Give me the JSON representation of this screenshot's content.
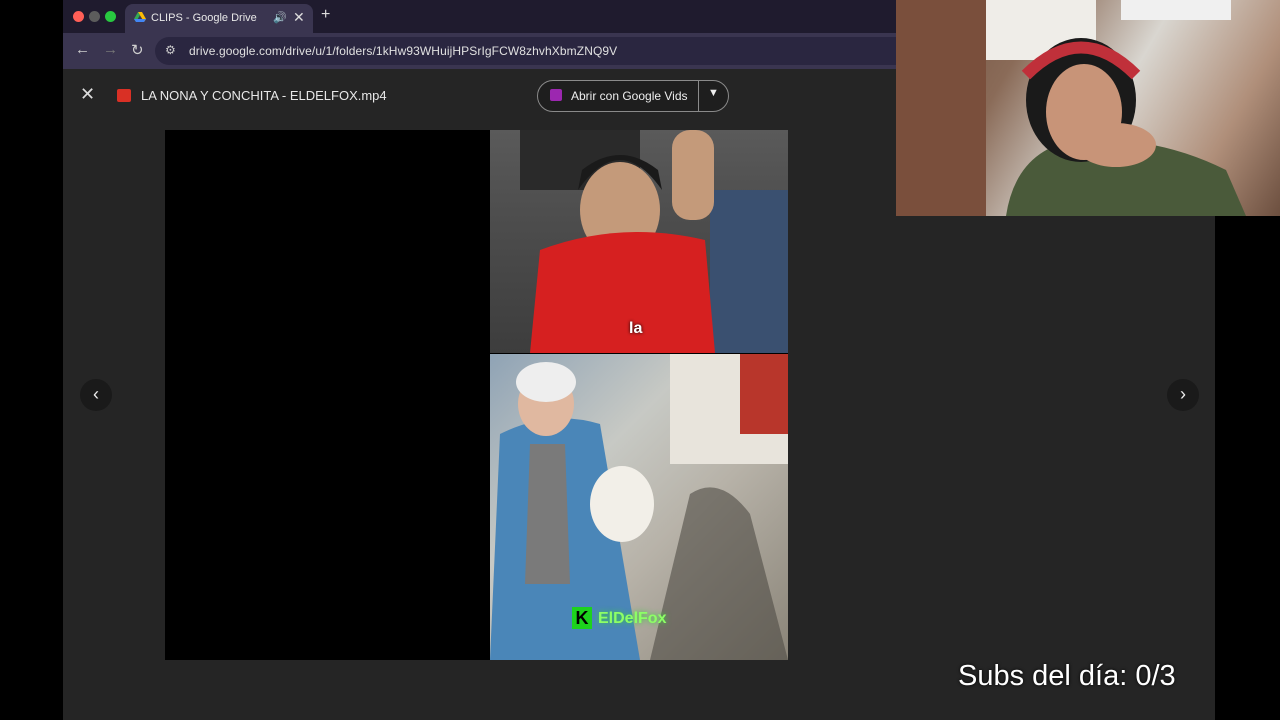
{
  "browser": {
    "tab_title": "CLIPS - Google Drive",
    "url": "drive.google.com/drive/u/1/folders/1kHw93WHuijHPSrIgFCW8zhvhXbmZNQ9V",
    "new_tab_glyph": "+",
    "close_tab_glyph": "✕"
  },
  "viewer": {
    "file_title": "LA NONA Y CONCHITA - ELDELFOX.mp4",
    "open_with_label": "Abrir con Google Vids",
    "video_caption": "la",
    "watermark_text": "ElDelFox",
    "watermark_letter": "K"
  },
  "overlay": {
    "subs_text": "Subs del día: 0/3"
  },
  "icons": [
    "close-icon",
    "back-icon",
    "forward-icon",
    "reload-icon",
    "site-info-icon",
    "speaker-icon",
    "prev-arrow-icon",
    "next-arrow-icon",
    "dropdown-caret-icon"
  ],
  "colors": {
    "titlebar": "#1f1b2e",
    "toolbar": "#3a3550",
    "vids": "#9c27b0",
    "watermark": "#8dff66"
  }
}
